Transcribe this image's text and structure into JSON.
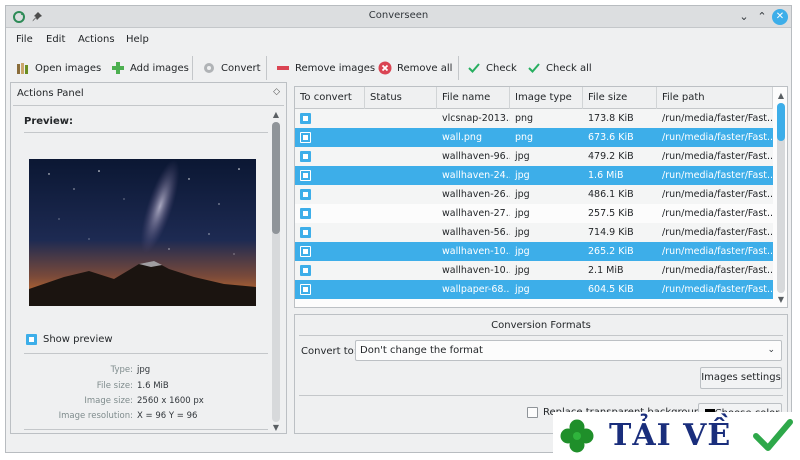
{
  "window": {
    "title": "Converseen"
  },
  "menu": [
    "File",
    "Edit",
    "Actions",
    "Help"
  ],
  "toolbar": {
    "open_images": "Open images",
    "add_images": "Add images",
    "convert": "Convert",
    "remove_images": "Remove images",
    "remove_all": "Remove all",
    "check": "Check",
    "check_all": "Check all"
  },
  "actions_panel": {
    "title": "Actions Panel",
    "preview_label": "Preview:",
    "show_preview": "Show preview",
    "show_preview_checked": true,
    "info": [
      {
        "key": "Type:",
        "value": "jpg"
      },
      {
        "key": "File size:",
        "value": "1.6 MiB"
      },
      {
        "key": "Image size:",
        "value": "2560 x 1600 px"
      },
      {
        "key": "Image resolution:",
        "value": "X = 96 Y = 96"
      }
    ]
  },
  "table": {
    "columns": [
      "To convert",
      "Status",
      "File name",
      "Image type",
      "File size",
      "File path"
    ],
    "rows": [
      {
        "checked": true,
        "status": "",
        "name": "vlcsnap-2013...",
        "type": "png",
        "size": "173.8 KiB",
        "path": "/run/media/faster/Fast...",
        "selected": false
      },
      {
        "checked": true,
        "status": "",
        "name": "wall.png",
        "type": "png",
        "size": "673.6 KiB",
        "path": "/run/media/faster/Fast...",
        "selected": true
      },
      {
        "checked": true,
        "status": "",
        "name": "wallhaven-96...",
        "type": "jpg",
        "size": "479.2 KiB",
        "path": "/run/media/faster/Fast...",
        "selected": false
      },
      {
        "checked": true,
        "status": "",
        "name": "wallhaven-24...",
        "type": "jpg",
        "size": "1.6 MiB",
        "path": "/run/media/faster/Fast...",
        "selected": true
      },
      {
        "checked": true,
        "status": "",
        "name": "wallhaven-26...",
        "type": "jpg",
        "size": "486.1 KiB",
        "path": "/run/media/faster/Fast...",
        "selected": false
      },
      {
        "checked": true,
        "status": "",
        "name": "wallhaven-27...",
        "type": "jpg",
        "size": "257.5 KiB",
        "path": "/run/media/faster/Fast...",
        "selected": false
      },
      {
        "checked": true,
        "status": "",
        "name": "wallhaven-56...",
        "type": "jpg",
        "size": "714.9 KiB",
        "path": "/run/media/faster/Fast...",
        "selected": false
      },
      {
        "checked": true,
        "status": "",
        "name": "wallhaven-10...",
        "type": "jpg",
        "size": "265.2 KiB",
        "path": "/run/media/faster/Fast...",
        "selected": true
      },
      {
        "checked": true,
        "status": "",
        "name": "wallhaven-10...",
        "type": "jpg",
        "size": "2.1 MiB",
        "path": "/run/media/faster/Fast...",
        "selected": false
      },
      {
        "checked": true,
        "status": "",
        "name": "wallpaper-68...",
        "type": "jpg",
        "size": "604.5 KiB",
        "path": "/run/media/faster/Fast...",
        "selected": true
      }
    ]
  },
  "conversion": {
    "title": "Conversion Formats",
    "convert_to_label": "Convert to:",
    "format_selected": "Don't change the format",
    "images_settings": "Images settings",
    "replace_transparent": "Replace transparent background",
    "replace_checked": false,
    "choose_color": "Choose color"
  },
  "watermark": {
    "text": "TẢI VỀ"
  },
  "colors": {
    "accent": "#3daee9",
    "window_bg": "#eff0f1",
    "selection": "#3daee9"
  }
}
